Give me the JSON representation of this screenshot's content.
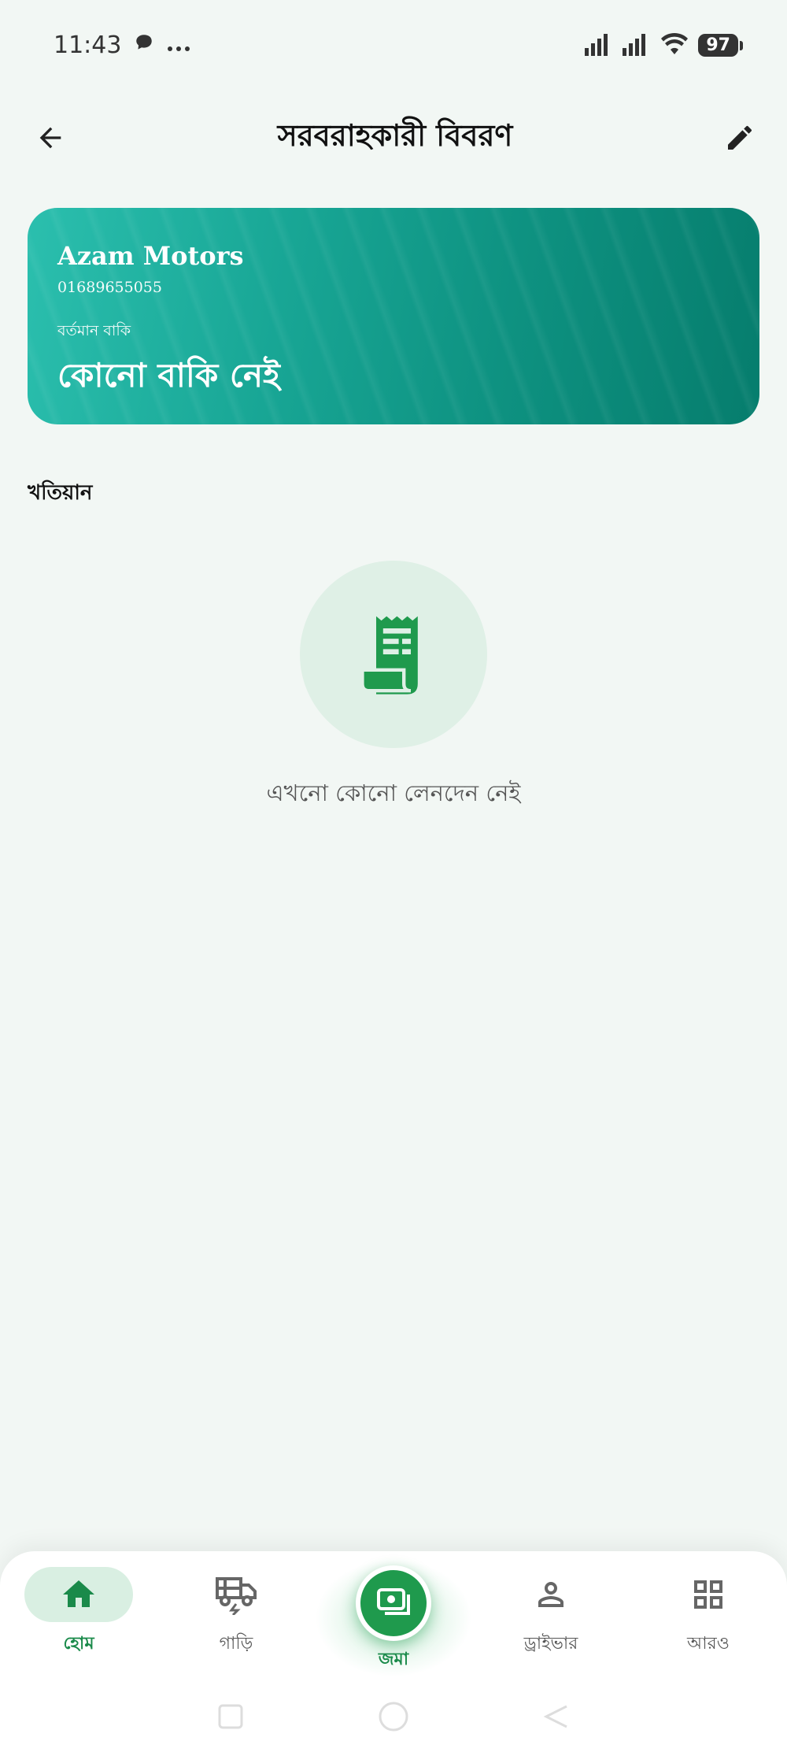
{
  "status": {
    "time": "11:43",
    "battery": "97"
  },
  "header": {
    "title": "সরবরাহকারী বিবরণ"
  },
  "supplier": {
    "name": "Azam Motors",
    "phone": "01689655055",
    "due_label": "বর্তমান বাকি",
    "due_value": "কোনো বাকি নেই"
  },
  "ledger": {
    "title": "খতিয়ান",
    "empty_text": "এখনো কোনো লেনদেন নেই"
  },
  "nav": {
    "items": [
      {
        "label": "হোম",
        "icon": "home-icon"
      },
      {
        "label": "গাড়ি",
        "icon": "vehicle-icon"
      },
      {
        "label": "জমা",
        "icon": "deposit-icon"
      },
      {
        "label": "ড্রাইভার",
        "icon": "person-icon"
      },
      {
        "label": "আরও",
        "icon": "grid-icon"
      }
    ]
  },
  "colors": {
    "brand": "#1f9a4d",
    "card_gradient_start": "#2bbfae",
    "card_gradient_end": "#067d6d",
    "background": "#f2f7f4"
  }
}
